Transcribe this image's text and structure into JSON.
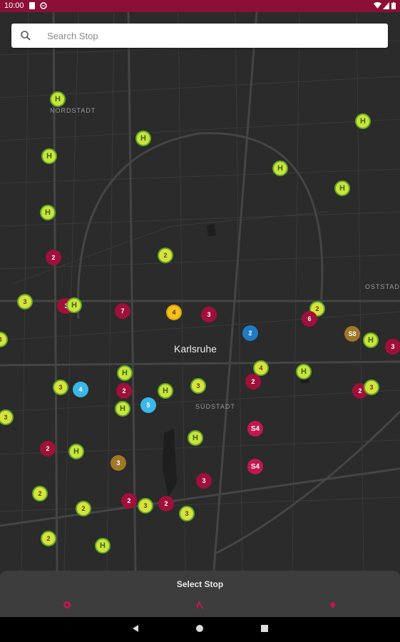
{
  "status_bar": {
    "time": "10:00",
    "background": "#8c0f35",
    "icons": [
      "sim-icon",
      "data-saver-icon",
      "wifi-icon",
      "signal-icon",
      "battery-icon"
    ]
  },
  "search": {
    "placeholder": "Search Stop"
  },
  "map": {
    "city_label": "Karlsruhe",
    "district_labels": {
      "nordstadt": "NORDSTADT",
      "suedstadt": "SÜDSTADT",
      "oststadt": "OSTSTAD"
    },
    "marker_colors": {
      "stop": "#cde33a",
      "cluster_red": "#a0103a",
      "cluster_blue": "#3ab8e8",
      "cluster_orange": "#f3c21b",
      "s_bahn": "#c3174f"
    },
    "markers": [
      {
        "label": "H",
        "type": "h"
      },
      {
        "label": "H",
        "type": "h"
      },
      {
        "label": "H",
        "type": "h"
      },
      {
        "label": "H",
        "type": "h"
      },
      {
        "label": "H",
        "type": "h"
      },
      {
        "label": "H",
        "type": "h"
      },
      {
        "label": "H",
        "type": "h"
      },
      {
        "label": "2",
        "type": "y"
      },
      {
        "label": "2",
        "type": "r"
      },
      {
        "label": "3",
        "type": "y"
      },
      {
        "label": "3",
        "type": "r"
      },
      {
        "label": "7",
        "type": "r"
      },
      {
        "label": "4",
        "type": "o"
      },
      {
        "label": "3",
        "type": "r"
      },
      {
        "label": "2",
        "type": "y"
      },
      {
        "label": "6",
        "type": "r"
      },
      {
        "label": "2",
        "type": "db"
      },
      {
        "label": "S8",
        "type": "br"
      },
      {
        "label": "H",
        "type": "h"
      },
      {
        "label": "3",
        "type": "r"
      },
      {
        "label": "4",
        "type": "y"
      },
      {
        "label": "H",
        "type": "h"
      },
      {
        "label": "2",
        "type": "r"
      },
      {
        "label": "2",
        "type": "r"
      },
      {
        "label": "3",
        "type": "y"
      },
      {
        "label": "4",
        "type": "b"
      },
      {
        "label": "H",
        "type": "h"
      },
      {
        "label": "2",
        "type": "r"
      },
      {
        "label": "H",
        "type": "h"
      },
      {
        "label": "3",
        "type": "y"
      },
      {
        "label": "5",
        "type": "b"
      },
      {
        "label": "H",
        "type": "h"
      },
      {
        "label": "3",
        "type": "y"
      },
      {
        "label": "S4",
        "type": "s"
      },
      {
        "label": "2",
        "type": "r"
      },
      {
        "label": "H",
        "type": "h"
      },
      {
        "label": "3",
        "type": "br"
      },
      {
        "label": "H",
        "type": "h"
      },
      {
        "label": "S4",
        "type": "s"
      },
      {
        "label": "3",
        "type": "r"
      },
      {
        "label": "2",
        "type": "y"
      },
      {
        "label": "2",
        "type": "y"
      },
      {
        "label": "2",
        "type": "r"
      },
      {
        "label": "3",
        "type": "y"
      },
      {
        "label": "2",
        "type": "r"
      },
      {
        "label": "3",
        "type": "y"
      },
      {
        "label": "2",
        "type": "y"
      },
      {
        "label": "H",
        "type": "h"
      },
      {
        "label": "3",
        "type": "y"
      },
      {
        "label": "3",
        "type": "y"
      },
      {
        "label": "3",
        "type": "r"
      },
      {
        "label": "H",
        "type": "h"
      }
    ]
  },
  "bottom_sheet": {
    "title": "Select Stop",
    "icons": [
      "location-icon",
      "walk-icon",
      "pin-icon"
    ]
  },
  "nav_bar": {
    "buttons": [
      "back-button",
      "home-button",
      "recents-button"
    ]
  }
}
